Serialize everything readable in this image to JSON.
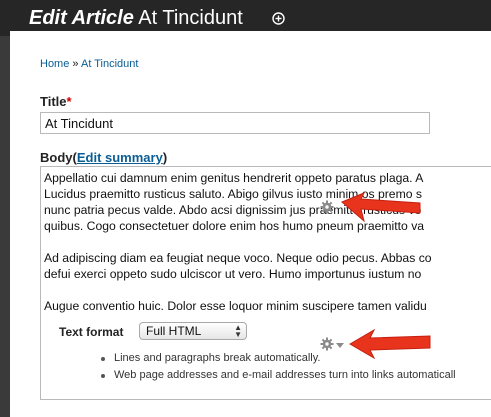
{
  "header": {
    "action": "Edit Article",
    "title": "At Tincidunt"
  },
  "breadcrumb": {
    "home": "Home",
    "separator": "»",
    "current": "At Tincidunt"
  },
  "title_field": {
    "label": "Title",
    "required_mark": "*",
    "value": "At Tincidunt"
  },
  "body_field": {
    "label": "Body",
    "summary_open": "(",
    "summary_link": "Edit summary",
    "summary_close": ")",
    "lines": [
      "Appellatio cui damnum enim genitus hendrerit oppeto paratus plaga. A",
      "Lucidus praemitto rusticus saluto. Abigo gilvus iusto minim os premo s",
      "nunc patria pecus valde. Abdo acsi dignissim jus praemitto rusticus vo",
      "quibus. Cogo consectetuer dolore enim hos humo pneum praemitto va",
      "",
      "Ad adipiscing diam ea feugiat neque voco. Neque odio pecus. Abbas co",
      "defui exerci oppeto sudo ulciscor ut vero. Humo importunus iustum no",
      "",
      "Augue conventio huic. Dolor esse loquor minim suscipere tamen validu"
    ]
  },
  "text_format": {
    "label": "Text format",
    "selected": "Full HTML",
    "tips": [
      "Lines and paragraphs break automatically.",
      "Web page addresses and e-mail addresses turn into links automaticall"
    ]
  },
  "icons": {
    "add": "plus-circle-icon",
    "configure": "gear-icon",
    "pointer": "red-arrow-icon"
  },
  "colors": {
    "link": "#0a5d95",
    "required": "#cc0000",
    "arrow": "#e8341c",
    "header_bg": "#262626"
  }
}
